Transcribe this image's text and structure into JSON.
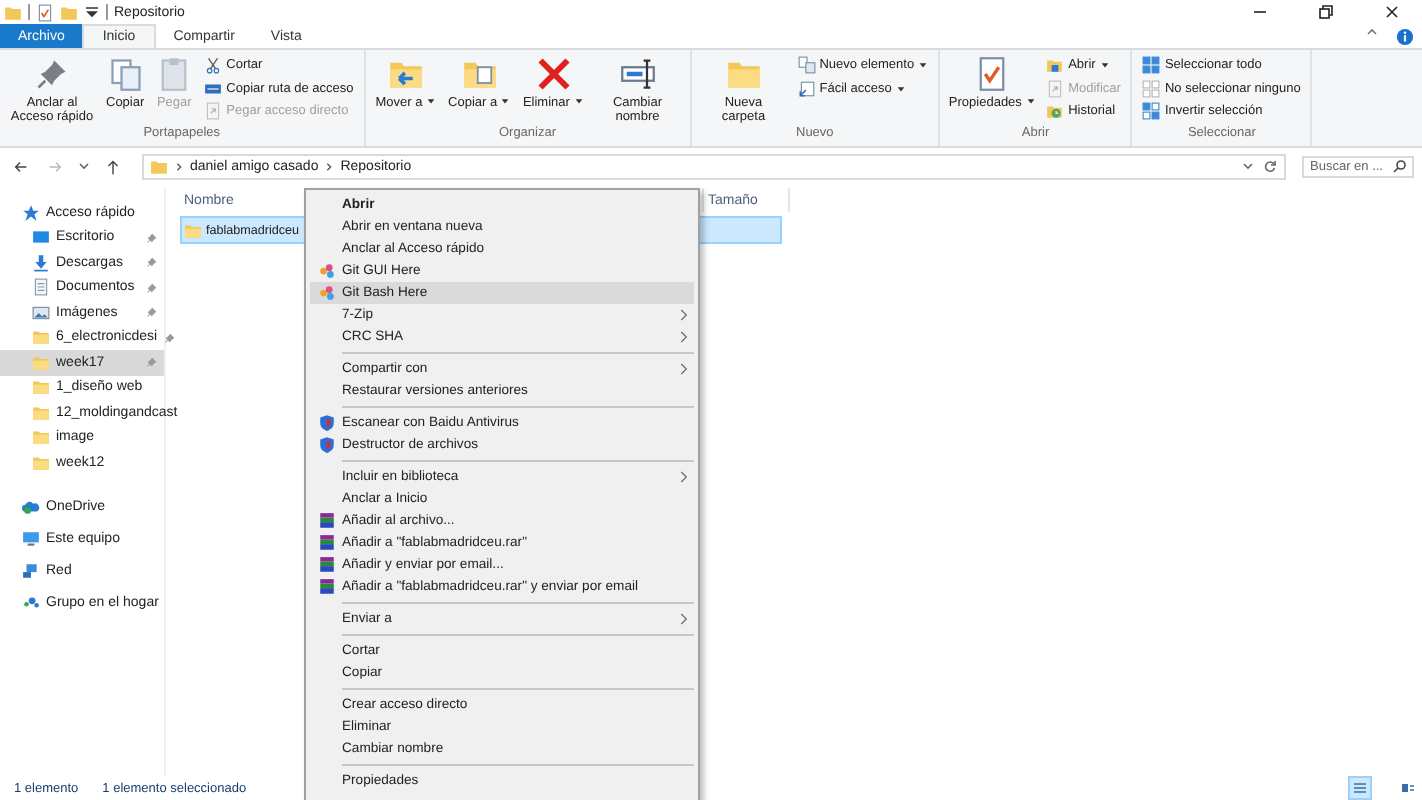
{
  "window": {
    "title": "Repositorio"
  },
  "ribbon_tabs": [
    {
      "label": "Archivo",
      "kind": "file",
      "selected": false
    },
    {
      "label": "Inicio",
      "kind": "tab",
      "selected": true
    },
    {
      "label": "Compartir",
      "kind": "tab",
      "selected": false
    },
    {
      "label": "Vista",
      "kind": "tab",
      "selected": false
    }
  ],
  "ribbon_groups": [
    {
      "label": "Portapapeles",
      "buttons": [
        {
          "label": "Anclar al Acceso rápido",
          "kind": "large",
          "disabled": false,
          "dropdown": false
        },
        {
          "label": "Copiar",
          "kind": "large",
          "disabled": false,
          "dropdown": false
        },
        {
          "label": "Pegar",
          "kind": "large",
          "disabled": true,
          "dropdown": false
        },
        {
          "label": "Cortar",
          "kind": "small",
          "disabled": false,
          "dropdown": false
        },
        {
          "label": "Copiar ruta de acceso",
          "kind": "small",
          "disabled": false,
          "dropdown": false
        },
        {
          "label": "Pegar acceso directo",
          "kind": "small",
          "disabled": true,
          "dropdown": false
        }
      ]
    },
    {
      "label": "Organizar",
      "buttons": [
        {
          "label": "Mover a",
          "kind": "large",
          "disabled": false,
          "dropdown": true
        },
        {
          "label": "Copiar a",
          "kind": "large",
          "disabled": false,
          "dropdown": true
        },
        {
          "label": "Eliminar",
          "kind": "large",
          "disabled": false,
          "dropdown": true
        },
        {
          "label": "Cambiar nombre",
          "kind": "large",
          "disabled": false,
          "dropdown": false
        }
      ]
    },
    {
      "label": "Nuevo",
      "buttons": [
        {
          "label": "Nueva carpeta",
          "kind": "large",
          "disabled": false,
          "dropdown": false
        },
        {
          "label": "Nuevo elemento",
          "kind": "small",
          "disabled": false,
          "dropdown": true
        },
        {
          "label": "Fácil acceso",
          "kind": "small",
          "disabled": false,
          "dropdown": true
        }
      ]
    },
    {
      "label": "Abrir",
      "buttons": [
        {
          "label": "Propiedades",
          "kind": "large",
          "disabled": false,
          "dropdown": true
        },
        {
          "label": "Abrir",
          "kind": "small",
          "disabled": false,
          "dropdown": true
        },
        {
          "label": "Modificar",
          "kind": "small",
          "disabled": true,
          "dropdown": false
        },
        {
          "label": "Historial",
          "kind": "small",
          "disabled": false,
          "dropdown": false
        }
      ]
    },
    {
      "label": "Seleccionar",
      "buttons": [
        {
          "label": "Seleccionar todo",
          "kind": "small",
          "disabled": false,
          "dropdown": false
        },
        {
          "label": "No seleccionar ninguno",
          "kind": "small",
          "disabled": false,
          "dropdown": false
        },
        {
          "label": "Invertir selección",
          "kind": "small",
          "disabled": false,
          "dropdown": false
        }
      ]
    }
  ],
  "address": {
    "breadcrumbs": [
      "daniel amigo casado",
      "Repositorio"
    ],
    "search_placeholder": "Buscar en ..."
  },
  "nav": [
    {
      "label": "Acceso rápido",
      "selected": false,
      "children": [
        {
          "label": "Escritorio",
          "selected": false,
          "pinned": true
        },
        {
          "label": "Descargas",
          "selected": false,
          "pinned": true
        },
        {
          "label": "Documentos",
          "selected": false,
          "pinned": true
        },
        {
          "label": "Imágenes",
          "selected": false,
          "pinned": true
        },
        {
          "label": "6_electronicdesi",
          "selected": false,
          "pinned": true
        },
        {
          "label": "week17",
          "selected": true,
          "pinned": true
        },
        {
          "label": "1_diseño web",
          "selected": false,
          "pinned": false
        },
        {
          "label": "12_moldingandcast",
          "selected": false,
          "pinned": false
        },
        {
          "label": "image",
          "selected": false,
          "pinned": false
        },
        {
          "label": "week12",
          "selected": false,
          "pinned": false
        }
      ]
    },
    {
      "label": "OneDrive",
      "selected": false
    },
    {
      "label": "Este equipo",
      "selected": false
    },
    {
      "label": "Red",
      "selected": false
    },
    {
      "label": "Grupo en el hogar",
      "selected": false
    }
  ],
  "columns": [
    "Nombre",
    "Tamaño"
  ],
  "files": [
    {
      "name": "fablabmadridceu",
      "selected": true
    }
  ],
  "context_menu": [
    {
      "kind": "item",
      "label": "Abrir",
      "bold": true,
      "submenu": false,
      "selected": false
    },
    {
      "kind": "item",
      "label": "Abrir en ventana nueva",
      "bold": false,
      "submenu": false,
      "selected": false
    },
    {
      "kind": "item",
      "label": "Anclar al Acceso rápido",
      "bold": false,
      "submenu": false,
      "selected": false
    },
    {
      "kind": "item",
      "label": "Git GUI Here",
      "bold": false,
      "submenu": false,
      "selected": false
    },
    {
      "kind": "item",
      "label": "Git Bash Here",
      "bold": false,
      "submenu": false,
      "selected": true
    },
    {
      "kind": "item",
      "label": "7-Zip",
      "bold": false,
      "submenu": true,
      "selected": false
    },
    {
      "kind": "item",
      "label": "CRC SHA",
      "bold": false,
      "submenu": true,
      "selected": false
    },
    {
      "kind": "separator"
    },
    {
      "kind": "item",
      "label": "Compartir con",
      "bold": false,
      "submenu": true,
      "selected": false
    },
    {
      "kind": "item",
      "label": "Restaurar versiones anteriores",
      "bold": false,
      "submenu": false,
      "selected": false
    },
    {
      "kind": "separator"
    },
    {
      "kind": "item",
      "label": "Escanear con Baidu Antivirus",
      "bold": false,
      "submenu": false,
      "selected": false
    },
    {
      "kind": "item",
      "label": "Destructor de archivos",
      "bold": false,
      "submenu": false,
      "selected": false
    },
    {
      "kind": "separator"
    },
    {
      "kind": "item",
      "label": "Incluir en biblioteca",
      "bold": false,
      "submenu": true,
      "selected": false
    },
    {
      "kind": "item",
      "label": "Anclar a Inicio",
      "bold": false,
      "submenu": false,
      "selected": false
    },
    {
      "kind": "item",
      "label": "Añadir al archivo...",
      "bold": false,
      "submenu": false,
      "selected": false
    },
    {
      "kind": "item",
      "label": "Añadir a \"fablabmadridceu.rar\"",
      "bold": false,
      "submenu": false,
      "selected": false
    },
    {
      "kind": "item",
      "label": "Añadir y enviar por email...",
      "bold": false,
      "submenu": false,
      "selected": false
    },
    {
      "kind": "item",
      "label": "Añadir a \"fablabmadridceu.rar\" y enviar por email",
      "bold": false,
      "submenu": false,
      "selected": false
    },
    {
      "kind": "separator"
    },
    {
      "kind": "item",
      "label": "Enviar a",
      "bold": false,
      "submenu": true,
      "selected": false
    },
    {
      "kind": "separator"
    },
    {
      "kind": "item",
      "label": "Cortar",
      "bold": false,
      "submenu": false,
      "selected": false
    },
    {
      "kind": "item",
      "label": "Copiar",
      "bold": false,
      "submenu": false,
      "selected": false
    },
    {
      "kind": "separator"
    },
    {
      "kind": "item",
      "label": "Crear acceso directo",
      "bold": false,
      "submenu": false,
      "selected": false
    },
    {
      "kind": "item",
      "label": "Eliminar",
      "bold": false,
      "submenu": false,
      "selected": false
    },
    {
      "kind": "item",
      "label": "Cambiar nombre",
      "bold": false,
      "submenu": false,
      "selected": false
    },
    {
      "kind": "separator"
    },
    {
      "kind": "item",
      "label": "Propiedades",
      "bold": false,
      "submenu": false,
      "selected": false
    }
  ],
  "status_bar": {
    "items_count": "1 elemento",
    "selection": "1 elemento seleccionado"
  },
  "views": [
    {
      "kind": "details",
      "selected": true
    },
    {
      "kind": "tiles",
      "selected": false
    }
  ]
}
